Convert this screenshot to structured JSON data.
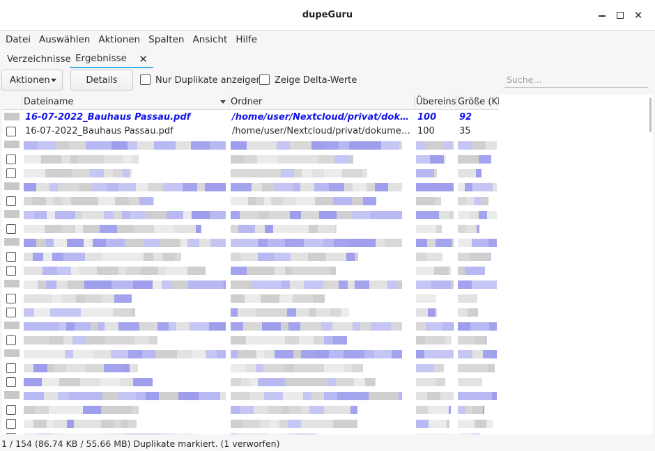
{
  "window": {
    "title": "dupeGuru"
  },
  "menubar": {
    "items": [
      "Datei",
      "Auswählen",
      "Aktionen",
      "Spalten",
      "Ansicht",
      "Hilfe"
    ]
  },
  "tabs": [
    {
      "label": "Verzeichnisse",
      "active": false
    },
    {
      "label": "Ergebnisse",
      "active": true
    }
  ],
  "toolbar": {
    "actions_label": "Aktionen",
    "details_label": "Details",
    "only_dupes_label": "Nur Duplikate anzeigen",
    "delta_label": "Zeige Delta-Werte",
    "search_placeholder": "Suche..."
  },
  "table": {
    "columns": [
      "Dateiname",
      "Ordner",
      "Übereinst",
      "Größe (KB"
    ],
    "rows": [
      {
        "reference": true,
        "name": "16-07-2022_Bauhaus Passau.pdf",
        "folder": "/home/user/Nextcloud/privat/dokume...",
        "match": "100",
        "size": "92"
      },
      {
        "reference": false,
        "name": "16-07-2022_Bauhaus Passau.pdf",
        "folder": "/home/user/Nextcloud/privat/dokument...",
        "match": "100",
        "size": "35"
      }
    ]
  },
  "status": {
    "text": "1 / 154 (86.74 KB / 55.66 MB) Duplikate markiert. (1 verworfen)"
  },
  "colors": {
    "reference_text": "#1515e6",
    "accent": "#3daee9",
    "reference_bg": "#c8c8c8"
  }
}
